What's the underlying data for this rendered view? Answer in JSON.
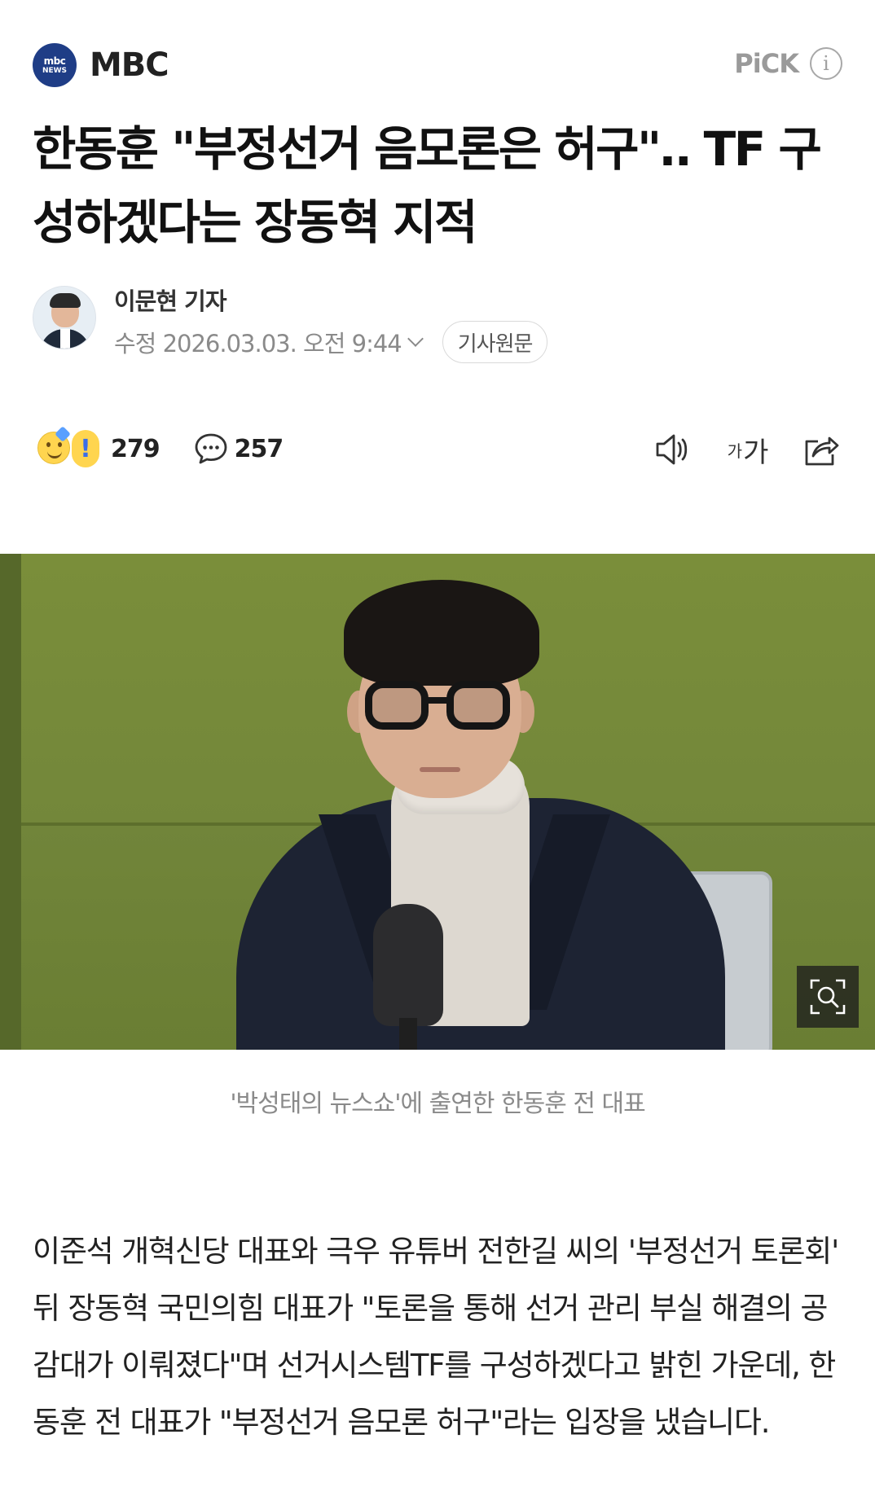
{
  "press": {
    "logo_line1": "mbc",
    "logo_line2": "NEWS",
    "name": "MBC",
    "pick_label": "PiCK",
    "info_symbol": "i",
    "brand_color": "#1f3d86"
  },
  "article": {
    "headline": "한동훈 \"부정선거 음모론은 허구\"‥ TF 구성하겠다는 장동혁 지적",
    "reporter": "이문현 기자",
    "modified": "수정 2026.03.03. 오전 9:44",
    "origin_button": "기사원문",
    "reaction_count": "279",
    "comment_count": "257",
    "font_tool_small": "가",
    "font_tool_large": "가",
    "caption": "'박성태의 뉴스쇼'에 출연한 한동훈 전 대표",
    "body": "이준석 개혁신당 대표와 극우 유튜버 전한길 씨의 '부정선거 토론회' 뒤 장동혁 국민의힘 대표가 \"토론을 통해 선거 관리 부실 해결의 공감대가 이뤄졌다\"며 선거시스템TF를 구성하겠다고 밝힌 가운데, 한동훈 전 대표가 \"부정선거 음모론 허구\"라는 입장을 냈습니다."
  },
  "icons": {
    "reaction": "emoji-reaction-icon",
    "comment": "speech-bubble-icon",
    "tts": "speaker-icon",
    "font": "font-size-icon",
    "share": "share-icon",
    "zoom": "zoom-search-icon"
  }
}
